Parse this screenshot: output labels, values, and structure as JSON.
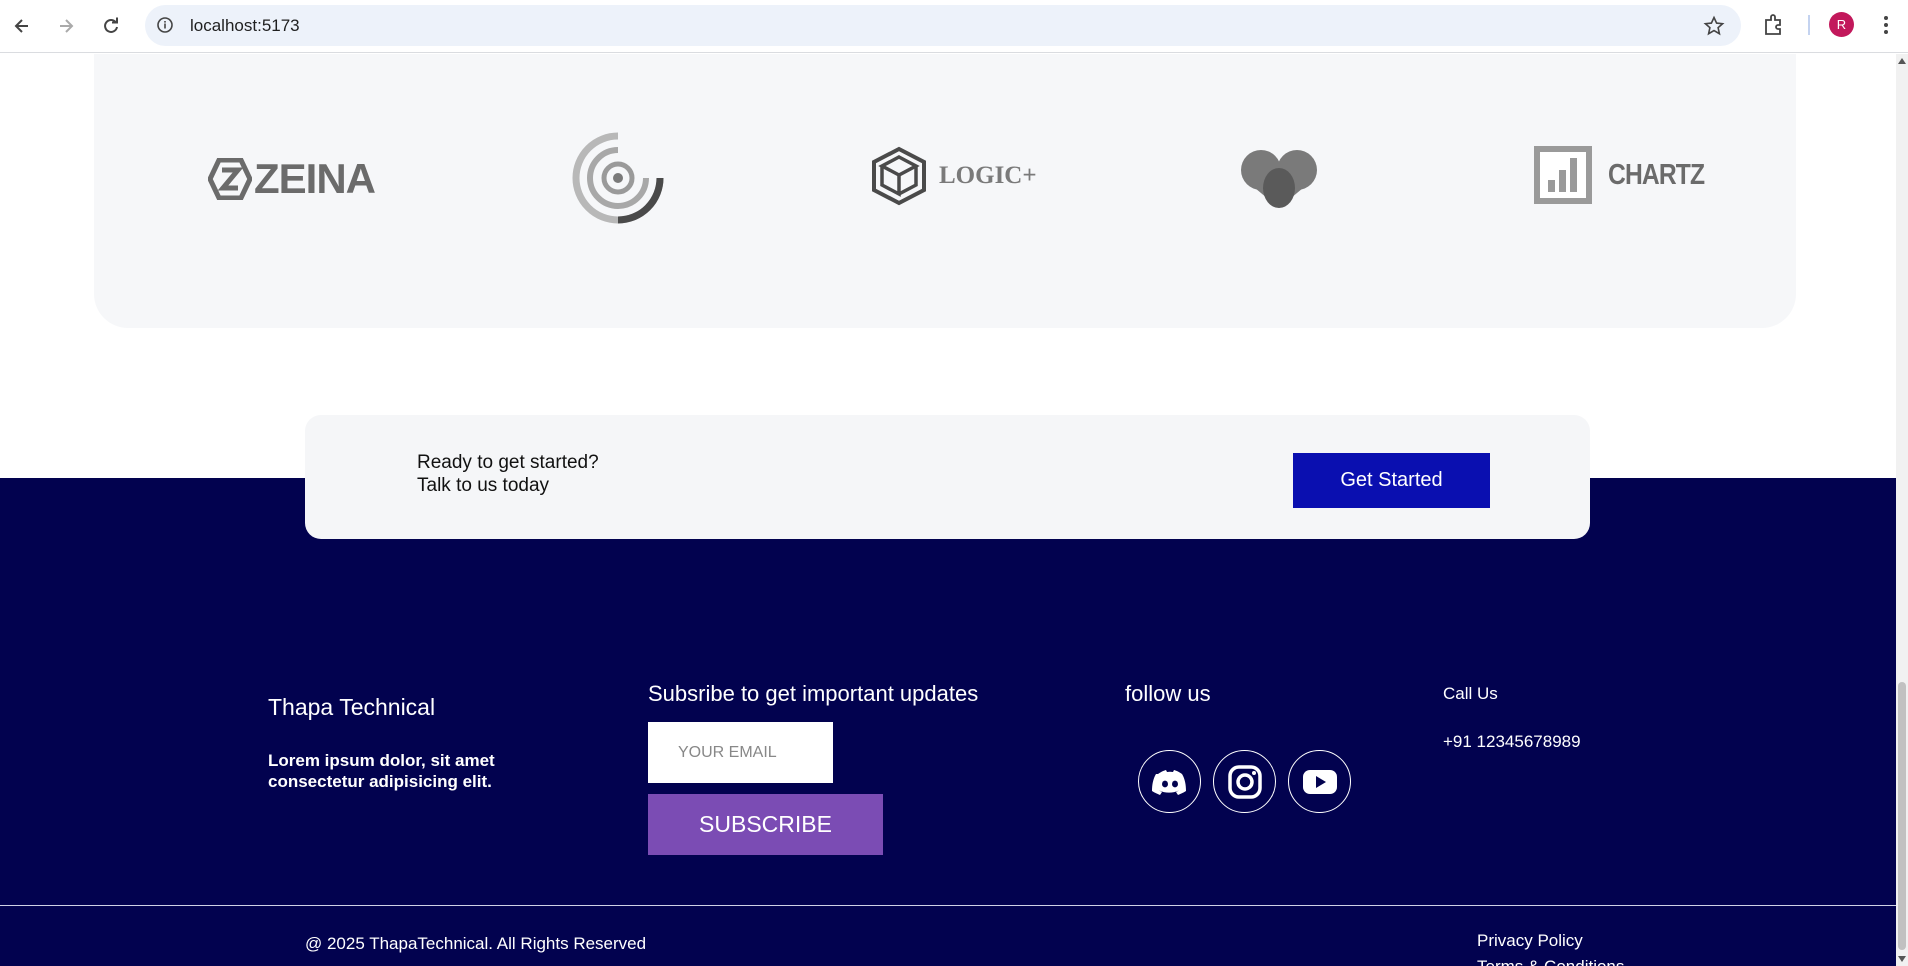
{
  "browser": {
    "url": "localhost:5173",
    "profile_initial": "R",
    "icons": [
      "back-icon",
      "forward-icon",
      "reload-icon",
      "site-info-icon",
      "star-icon",
      "extensions-icon",
      "kebab-menu-icon"
    ]
  },
  "logos": {
    "items": [
      {
        "name": "zeina",
        "text": "ZEINA"
      },
      {
        "name": "target-ring",
        "text": ""
      },
      {
        "name": "logic-plus",
        "text": "LOGIC+"
      },
      {
        "name": "heart",
        "text": ""
      },
      {
        "name": "chartz",
        "text": "CHARTZ"
      }
    ]
  },
  "cta": {
    "line1": "Ready to get started?",
    "line2": "Talk to us today",
    "button": "Get Started",
    "button_color": "#0a0fb0"
  },
  "footer": {
    "background": "#02024f",
    "brand": "Thapa Technical",
    "blurb": "Lorem ipsum dolor, sit amet consectetur adipisicing elit.",
    "subscribe_title": "Subsribe to get important updates",
    "email_placeholder": "YOUR EMAIL",
    "subscribe_button": "SUBSCRIBE",
    "subscribe_color": "#7b4cb4",
    "follow_title": "follow us",
    "social": [
      "discord-icon",
      "instagram-icon",
      "youtube-icon"
    ],
    "call_title": "Call Us",
    "phone": "+91 12345678989",
    "copyright": "@ 2025 ThapaTechnical. All Rights Reserved",
    "privacy": "Privacy Policy",
    "terms": "Terms & Conditions"
  }
}
